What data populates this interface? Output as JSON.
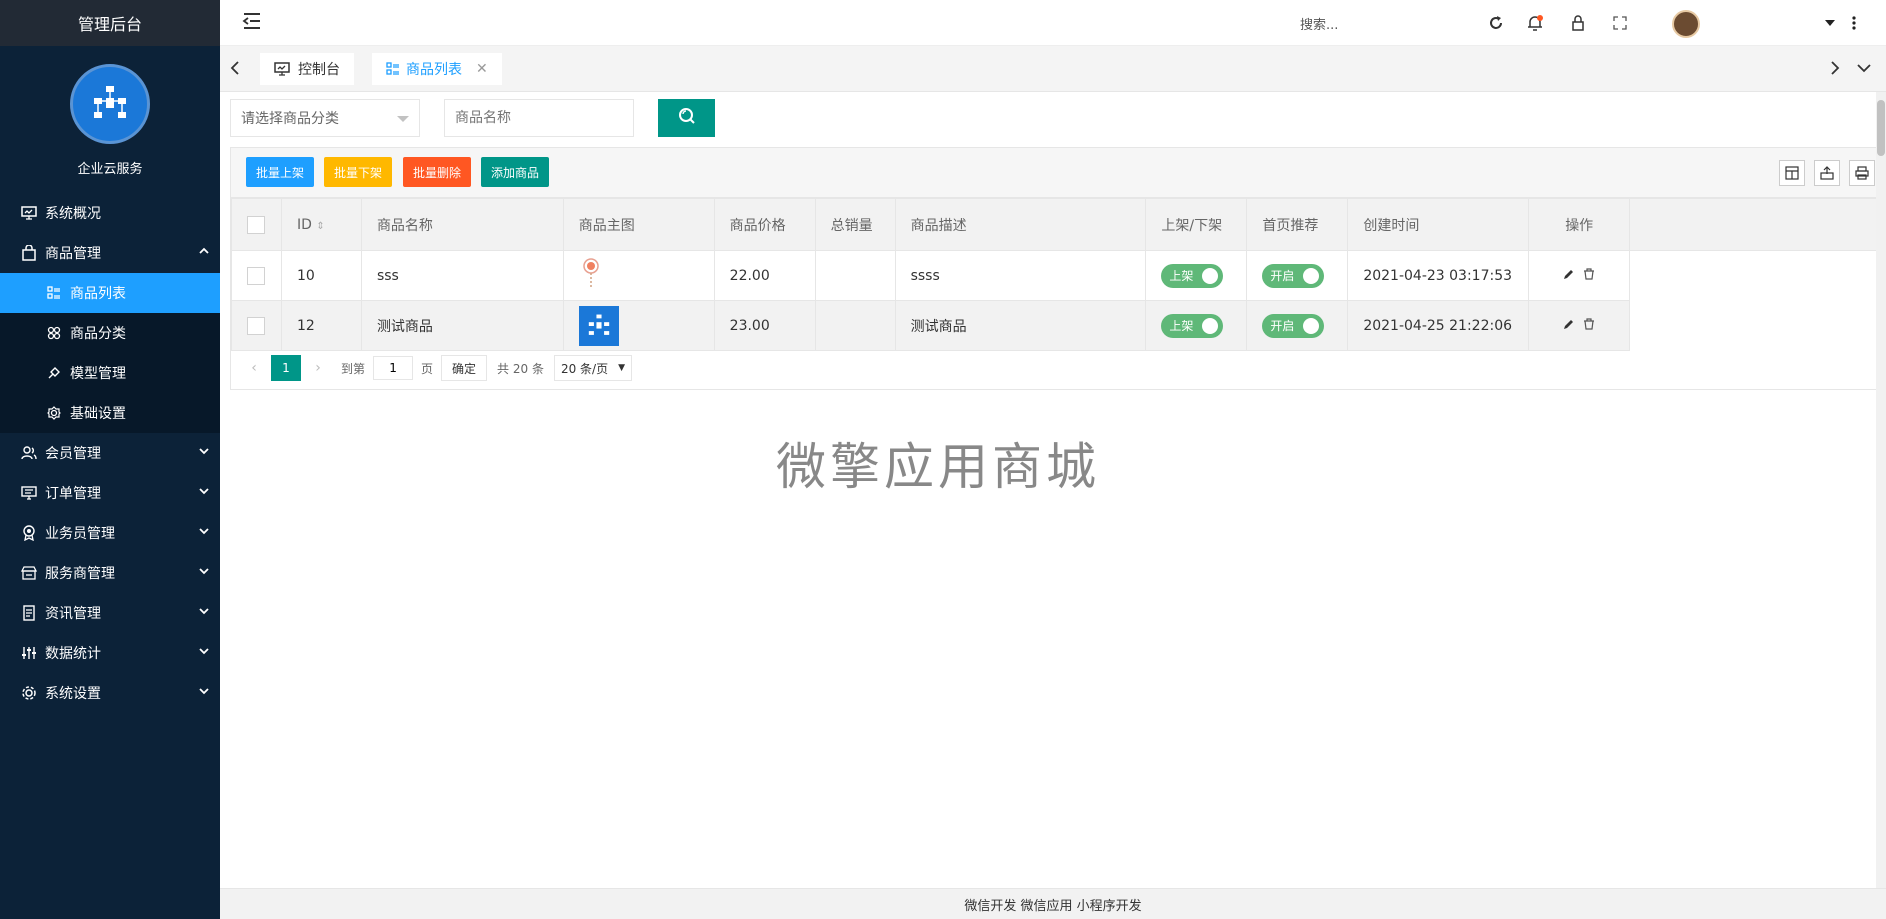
{
  "sidebar": {
    "title": "管理后台",
    "company": "企业云服务",
    "items": [
      {
        "label": "系统概况",
        "icon": "monitor-icon"
      },
      {
        "label": "商品管理",
        "icon": "shop-bag-icon",
        "expanded": true
      },
      {
        "label": "会员管理",
        "icon": "users-icon"
      },
      {
        "label": "订单管理",
        "icon": "order-icon"
      },
      {
        "label": "业务员管理",
        "icon": "badge-icon"
      },
      {
        "label": "服务商管理",
        "icon": "store-icon"
      },
      {
        "label": "资讯管理",
        "icon": "document-icon"
      },
      {
        "label": "数据统计",
        "icon": "sliders-icon"
      },
      {
        "label": "系统设置",
        "icon": "gear-icon"
      }
    ],
    "submenu": [
      {
        "label": "商品列表",
        "icon": "list-icon",
        "active": true
      },
      {
        "label": "商品分类",
        "icon": "grid-icon"
      },
      {
        "label": "模型管理",
        "icon": "model-icon"
      },
      {
        "label": "基础设置",
        "icon": "settings-icon"
      }
    ]
  },
  "header": {
    "search_placeholder": "搜索..."
  },
  "tabs": [
    {
      "label": "控制台",
      "icon": "monitor-icon"
    },
    {
      "label": "商品列表",
      "icon": "list-icon",
      "active": true
    }
  ],
  "filters": {
    "category_placeholder": "请选择商品分类",
    "name_placeholder": "商品名称"
  },
  "toolbar": {
    "batch_on": "批量上架",
    "batch_off": "批量下架",
    "batch_delete": "批量删除",
    "add": "添加商品"
  },
  "table": {
    "columns": [
      "ID",
      "商品名称",
      "商品主图",
      "商品价格",
      "总销量",
      "商品描述",
      "上架/下架",
      "首页推荐",
      "创建时间",
      "操作"
    ],
    "rows": [
      {
        "id": "10",
        "name": "sss",
        "price": "22.00",
        "sales": "",
        "desc": "ssss",
        "status": "上架",
        "recommend": "开启",
        "created": "2021-04-23 03:17:53"
      },
      {
        "id": "12",
        "name": "测试商品",
        "price": "23.00",
        "sales": "",
        "desc": "测试商品",
        "status": "上架",
        "recommend": "开启",
        "created": "2021-04-25 21:22:06"
      }
    ]
  },
  "pager": {
    "current": "1",
    "goto_label": "到第",
    "page_input": "1",
    "page_label": "页",
    "confirm": "确定",
    "total": "共 20 条",
    "limit": "20 条/页"
  },
  "watermark": "微擎应用商城",
  "footer": "微信开发 微信应用 小程序开发",
  "colors": {
    "sidebar_bg": "#0c2238",
    "accent_blue": "#1e9fff",
    "accent_green": "#009688",
    "yellow": "#ffb800",
    "red": "#ff5722",
    "switch_green": "#5fb878"
  }
}
